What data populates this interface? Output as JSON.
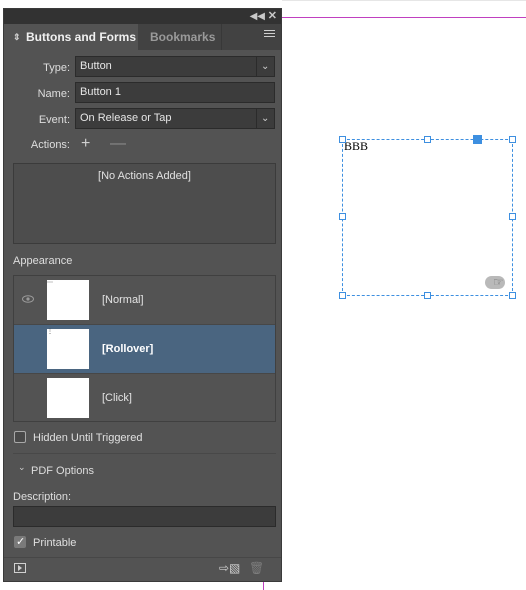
{
  "panel": {
    "tabs": [
      {
        "label": "Buttons and Forms",
        "active": true
      },
      {
        "label": "Bookmarks",
        "active": false
      }
    ],
    "type_label": "Type:",
    "type_value": "Button",
    "name_label": "Name:",
    "name_value": "Button 1",
    "event_label": "Event:",
    "event_value": "On Release or Tap",
    "actions_label": "Actions:",
    "actions_empty": "[No Actions Added]",
    "appearance_label": "Appearance",
    "states": [
      {
        "label": "[Normal]",
        "selected": false,
        "visible": true
      },
      {
        "label": "[Rollover]",
        "selected": true,
        "visible": false
      },
      {
        "label": "[Click]",
        "selected": false,
        "visible": false
      }
    ],
    "hidden_until_triggered": {
      "label": "Hidden Until Triggered",
      "checked": false
    },
    "pdf_options_label": "PDF Options",
    "description_label": "Description:",
    "description_value": "",
    "printable": {
      "label": "Printable",
      "checked": true
    }
  },
  "canvas": {
    "frame_text": "BBB"
  },
  "icons": {
    "add": "plus-icon",
    "remove": "minus-icon",
    "eye": "eye-icon",
    "preview": "preview-icon",
    "convert": "convert-object-icon",
    "trash": "trash-icon"
  },
  "colors": {
    "panel_bg": "#535353",
    "selection_blue": "#3d8fe0",
    "selected_row": "#4a6580",
    "guide_magenta": "#c040c0"
  }
}
